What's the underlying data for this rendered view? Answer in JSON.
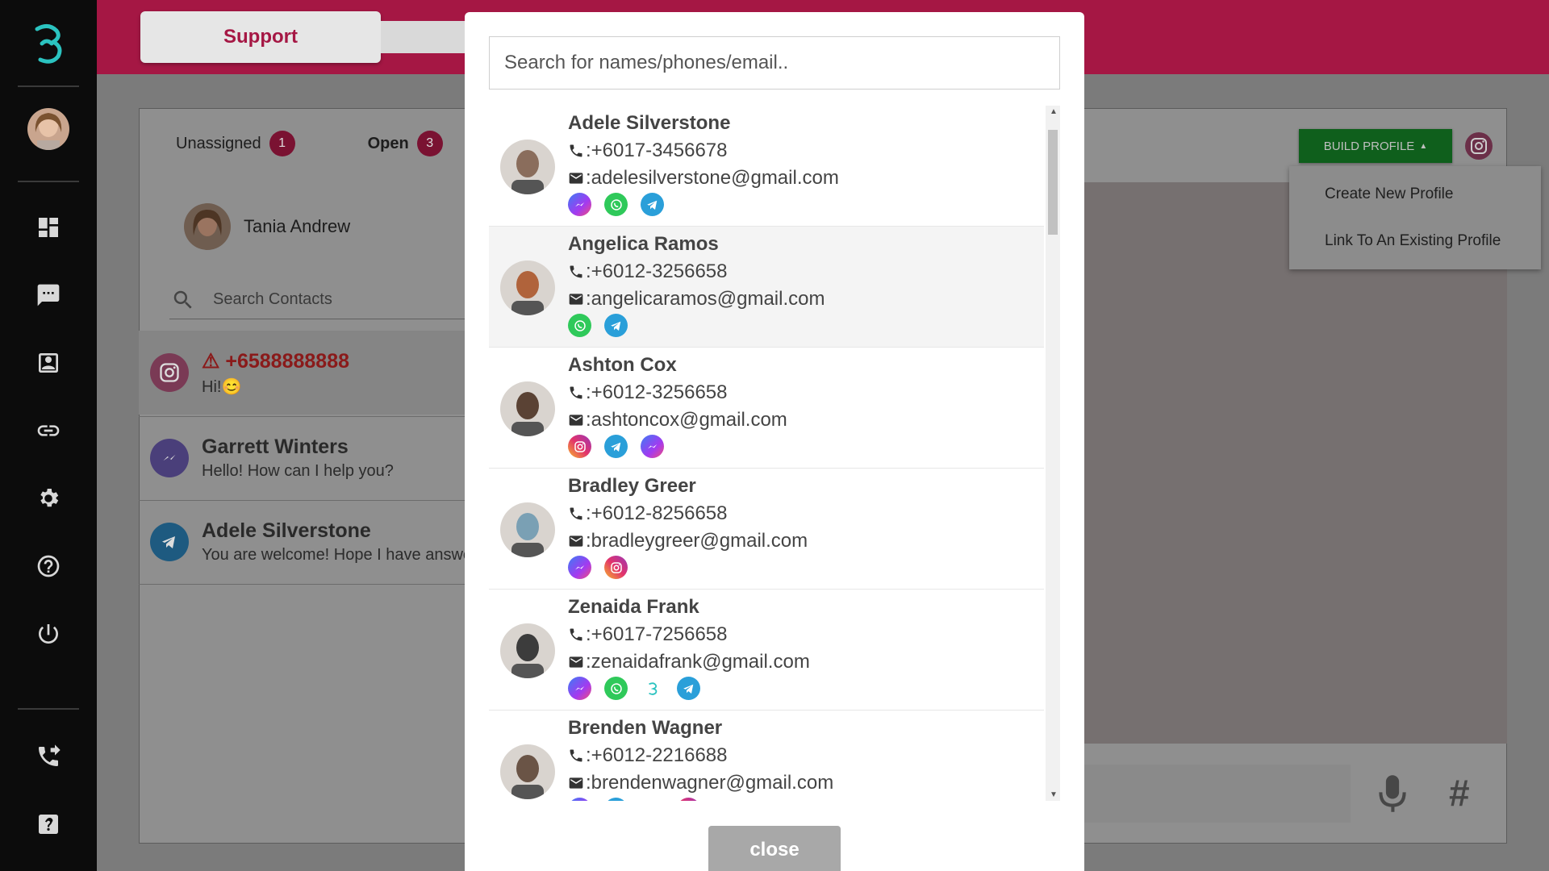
{
  "header": {
    "support_tab": "Support"
  },
  "sidebar": {
    "icons": [
      "dashboard-icon",
      "chat-icon",
      "contacts-icon",
      "link-icon",
      "settings-icon",
      "help-icon",
      "power-icon",
      "phone-forward-icon",
      "help-box-icon"
    ]
  },
  "inbox": {
    "tabs": [
      {
        "label": "Unassigned",
        "count": "1"
      },
      {
        "label": "Open",
        "count": "3"
      }
    ],
    "agent_name": "Tania Andrew",
    "search_placeholder": "Search Contacts",
    "conversations": [
      {
        "channel": "instagram",
        "name": "+6588888888",
        "message": "Hi!😊",
        "warning": true
      },
      {
        "channel": "messenger",
        "name": "Garrett Winters",
        "message": "Hello! How can I help you?"
      },
      {
        "channel": "telegram",
        "name": "Adele Silverstone",
        "message": "You are welcome! Hope I have answered"
      }
    ]
  },
  "profile": {
    "build_button": "BUILD PROFILE",
    "menu": [
      "Create New Profile",
      "Link To An Existing Profile"
    ]
  },
  "modal": {
    "search_placeholder": "Search for names/phones/email..",
    "close_label": "close",
    "contacts": [
      {
        "name": "Adele Silverstone",
        "phone": ":+6017-3456678",
        "email": ":adelesilverstone@gmail.com",
        "channels": [
          "messenger",
          "whatsapp",
          "telegram"
        ],
        "avatar_color": "#8a6d5c"
      },
      {
        "name": "Angelica Ramos",
        "phone": ":+6012-3256658",
        "email": ":angelicaramos@gmail.com",
        "channels": [
          "whatsapp",
          "telegram"
        ],
        "avatar_color": "#b0633b"
      },
      {
        "name": "Ashton Cox",
        "phone": ":+6012-3256658",
        "email": ":ashtoncox@gmail.com",
        "channels": [
          "instagram",
          "telegram",
          "messenger"
        ],
        "avatar_color": "#5a4234"
      },
      {
        "name": "Bradley Greer",
        "phone": ":+6012-8256658",
        "email": ":bradleygreer@gmail.com",
        "channels": [
          "messenger",
          "instagram"
        ],
        "avatar_color": "#7aa0b4"
      },
      {
        "name": "Zenaida Frank",
        "phone": ":+6017-7256658",
        "email": ":zenaidafrank@gmail.com",
        "channels": [
          "messenger",
          "whatsapp",
          "brand",
          "telegram"
        ],
        "avatar_color": "#3c3c3c"
      },
      {
        "name": "Brenden Wagner",
        "phone": ":+6012-2216688",
        "email": ":brendenwagner@gmail.com",
        "channels": [
          "messenger",
          "telegram",
          "brand",
          "instagram"
        ],
        "avatar_color": "#6a5446"
      }
    ]
  },
  "colors": {
    "brand": "#a51744",
    "teal": "#2bc3c0",
    "green": "#0f5f1c"
  }
}
